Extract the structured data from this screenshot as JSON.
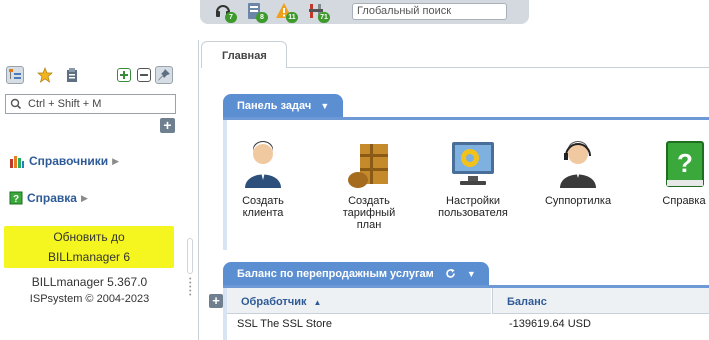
{
  "toolbar": {
    "badges": [
      "7",
      "8",
      "11",
      "71"
    ],
    "search_placeholder": "Глобальный поиск"
  },
  "sidebar": {
    "search_placeholder": "Ctrl + Shift + M",
    "items": [
      {
        "label": "Справочники",
        "icon": "bar-chart-icon"
      },
      {
        "label": "Справка",
        "icon": "help-book-icon"
      }
    ],
    "upgrade_line1": "Обновить до",
    "upgrade_line2": "BILLmanager 6",
    "version": "BILLmanager 5.367.0",
    "copyright": "ISPsystem © 2004-2023"
  },
  "tabs": [
    {
      "label": "Главная"
    }
  ],
  "task_panel": {
    "title": "Панель задач",
    "tasks": [
      {
        "label": "Создать клиента"
      },
      {
        "label": "Создать тарифный план"
      },
      {
        "label": "Настройки пользователя"
      },
      {
        "label": "Суппортилка"
      },
      {
        "label": "Справка"
      }
    ]
  },
  "balance_panel": {
    "title": "Баланс по перепродажным услугам",
    "columns": [
      "Обработчик",
      "Баланс"
    ],
    "rows": [
      {
        "handler": "SSL The SSL Store",
        "balance": "-139619.64 USD"
      }
    ]
  },
  "colors": {
    "accent": "#5c8fd2",
    "link": "#2e5b97",
    "upgrade_bg": "#f5f51f",
    "badge_green": "#3f9a2d"
  }
}
